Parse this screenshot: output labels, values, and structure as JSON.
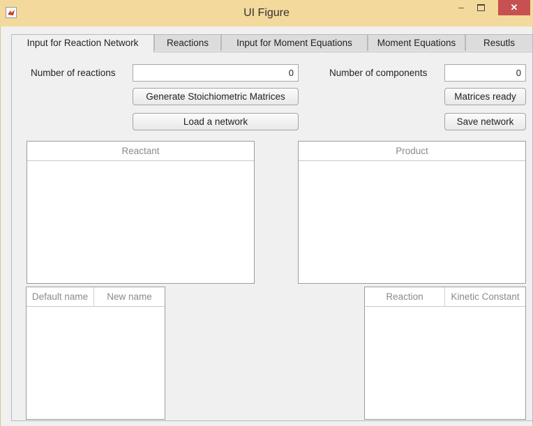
{
  "window": {
    "title": "UI Figure",
    "minimize_glyph": "–",
    "close_glyph": "✕",
    "icon": "matlab-figure-icon"
  },
  "tabs": [
    {
      "label": "Input for Reaction Network",
      "active": true
    },
    {
      "label": "Reactions",
      "active": false
    },
    {
      "label": "Input for Moment Equations",
      "active": false
    },
    {
      "label": "Moment Equations",
      "active": false
    },
    {
      "label": "Resutls",
      "active": false
    }
  ],
  "form": {
    "num_reactions_label": "Number of reactions",
    "num_reactions_value": "0",
    "num_components_label": "Number of components",
    "num_components_value": "0"
  },
  "buttons": {
    "generate": "Generate Stoichiometric Matrices",
    "load": "Load a network",
    "matrices_ready": "Matrices ready",
    "save": "Save network"
  },
  "tables": {
    "reactant": {
      "columns": [
        "Reactant"
      ]
    },
    "product": {
      "columns": [
        "Product"
      ]
    },
    "names": {
      "columns": [
        "Default name",
        "New name"
      ]
    },
    "kinetics": {
      "columns": [
        "Reaction",
        "Kinetic Constant"
      ]
    }
  }
}
